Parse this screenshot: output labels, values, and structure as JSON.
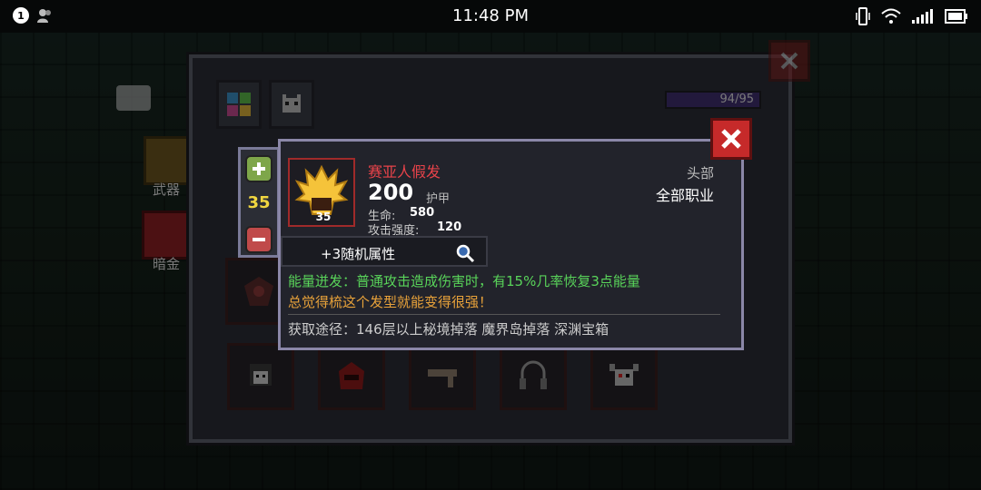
{
  "status_bar": {
    "notification_count": "1",
    "time": "11:48 PM"
  },
  "hud": {
    "weapon_label": "武器",
    "dark_gold_label": "暗金"
  },
  "inventory": {
    "capacity": "94/95"
  },
  "stepper": {
    "value": "35"
  },
  "item": {
    "name": "赛亚人假发",
    "level": "35",
    "main_stat_value": "200",
    "main_stat_label": "护甲",
    "attributes": [
      {
        "label": "生命:",
        "value": "580"
      },
      {
        "label": "攻击强度:",
        "value": "120"
      }
    ],
    "slot": "头部",
    "class": "全部职业",
    "random_attributes": "+3随机属性",
    "effect_text": "能量迸发：普通攻击造成伤害时，有15%几率恢复3点能量",
    "flavor_text": "总觉得梳这个发型就能变得很强！",
    "source_text": "获取途径：146层以上秘境掉落 魔界岛掉落 深渊宝箱"
  },
  "colors": {
    "item_name": "#e8434a",
    "effect": "#59d45a",
    "flavor": "#e8a23a",
    "stepper_value": "#f0d640",
    "close_button": "#c62a2a"
  },
  "icons": {
    "close": "close-icon",
    "plus": "plus-icon",
    "minus": "minus-icon",
    "magnifier": "magnifier-icon",
    "item": "golden-hair-icon"
  }
}
